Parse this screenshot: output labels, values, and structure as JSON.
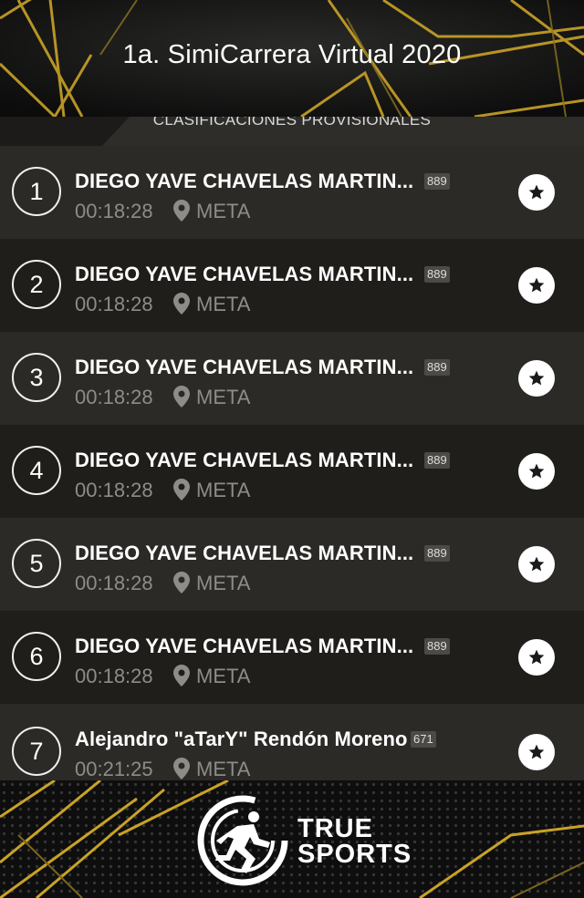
{
  "header": {
    "title": "1a. SimiCarrera Virtual 2020"
  },
  "subheader": {
    "label": "CLASIFICACIONES PROVISIONALES"
  },
  "results": [
    {
      "position": "1",
      "name": "DIEGO YAVE CHAVELAS MARTIN...",
      "bib": "889",
      "time": "00:18:28",
      "checkpoint": "META"
    },
    {
      "position": "2",
      "name": "DIEGO YAVE CHAVELAS MARTIN...",
      "bib": "889",
      "time": "00:18:28",
      "checkpoint": "META"
    },
    {
      "position": "3",
      "name": "DIEGO YAVE CHAVELAS MARTIN...",
      "bib": "889",
      "time": "00:18:28",
      "checkpoint": "META"
    },
    {
      "position": "4",
      "name": "DIEGO YAVE CHAVELAS MARTIN...",
      "bib": "889",
      "time": "00:18:28",
      "checkpoint": "META"
    },
    {
      "position": "5",
      "name": "DIEGO YAVE CHAVELAS MARTIN...",
      "bib": "889",
      "time": "00:18:28",
      "checkpoint": "META"
    },
    {
      "position": "6",
      "name": "DIEGO YAVE CHAVELAS MARTIN...",
      "bib": "889",
      "time": "00:18:28",
      "checkpoint": "META"
    },
    {
      "position": "7",
      "name": "Alejandro \"aTarY\" Rendón Moreno",
      "bib": "671",
      "time": "00:21:25",
      "checkpoint": "META"
    }
  ],
  "icons": {
    "checkpoint": "map-pin-icon",
    "favorite": "star-icon"
  },
  "footer": {
    "logo_line1": "TRUE",
    "logo_line2": "SPORTS"
  },
  "colors": {
    "accent_gold": "#c9a227",
    "row_dark": "#1f1e1b",
    "row_light": "#2b2a26"
  }
}
